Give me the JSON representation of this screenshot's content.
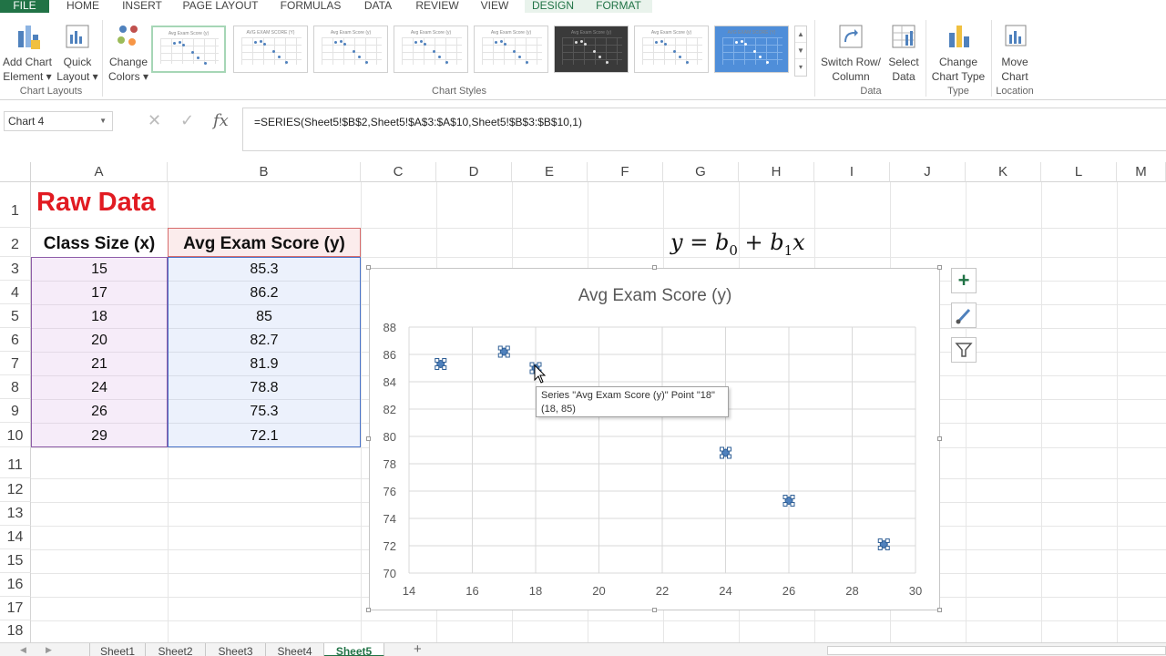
{
  "ribbon": {
    "tabs": [
      {
        "label": "FILE",
        "kind": "file"
      },
      {
        "label": "HOME"
      },
      {
        "label": "INSERT"
      },
      {
        "label": "PAGE LAYOUT"
      },
      {
        "label": "FORMULAS"
      },
      {
        "label": "DATA"
      },
      {
        "label": "REVIEW"
      },
      {
        "label": "VIEW"
      },
      {
        "label": "DESIGN",
        "kind": "ctx"
      },
      {
        "label": "FORMAT",
        "kind": "ctx"
      }
    ],
    "add_chart_element": {
      "line1": "Add Chart",
      "line2": "Element ▾"
    },
    "quick_layout": {
      "line1": "Quick",
      "line2": "Layout ▾"
    },
    "change_colors": {
      "line1": "Change",
      "line2": "Colors ▾"
    },
    "group_chart_layouts": "Chart Layouts",
    "group_chart_styles": "Chart Styles",
    "switch_row_column": {
      "line1": "Switch Row/",
      "line2": "Column"
    },
    "select_data": {
      "line1": "Select",
      "line2": "Data"
    },
    "group_data": "Data",
    "change_chart_type": {
      "line1": "Change",
      "line2": "Chart Type"
    },
    "group_type": "Type",
    "move_chart": {
      "line1": "Move",
      "line2": "Chart"
    },
    "group_location": "Location",
    "style_thumbnails": 8
  },
  "formula_bar": {
    "name_box": "Chart 4",
    "cancel_glyph": "✕",
    "enter_glyph": "✓",
    "fx_glyph": "fx",
    "formula": "=SERIES(Sheet5!$B$2,Sheet5!$A$3:$A$10,Sheet5!$B$3:$B$10,1)"
  },
  "grid": {
    "columns": [
      "A",
      "B",
      "C",
      "D",
      "E",
      "F",
      "G",
      "H",
      "I",
      "J",
      "K",
      "L",
      "M"
    ],
    "rows": [
      "1",
      "2",
      "3",
      "4",
      "5",
      "6",
      "7",
      "8",
      "9",
      "10",
      "11",
      "12",
      "13",
      "14",
      "15",
      "16",
      "17",
      "18"
    ],
    "title": "Raw Data",
    "header_x": "Class Size (x)",
    "header_y": "Avg Exam Score (y)",
    "data": [
      {
        "x": "15",
        "y": "85.3"
      },
      {
        "x": "17",
        "y": "86.2"
      },
      {
        "x": "18",
        "y": "85"
      },
      {
        "x": "20",
        "y": "82.7"
      },
      {
        "x": "21",
        "y": "81.9"
      },
      {
        "x": "24",
        "y": "78.8"
      },
      {
        "x": "26",
        "y": "75.3"
      },
      {
        "x": "29",
        "y": "72.1"
      }
    ]
  },
  "equation": {
    "y": "y",
    "eq": " = ",
    "b": "b",
    "s0": "0",
    "plus": " + ",
    "s1": "1",
    "x": "x"
  },
  "chart_data": {
    "type": "scatter",
    "title": "Avg Exam Score (y)",
    "xlim": [
      14,
      30
    ],
    "ylim": [
      70,
      88
    ],
    "x_ticks": [
      "14",
      "16",
      "18",
      "20",
      "22",
      "24",
      "26",
      "28",
      "30"
    ],
    "y_ticks": [
      "70",
      "72",
      "74",
      "76",
      "78",
      "80",
      "82",
      "84",
      "86",
      "88"
    ],
    "grid": true,
    "marker_color": "#4f81bd",
    "series": [
      {
        "name": "Avg Exam Score (y)",
        "points": [
          {
            "x": 15,
            "y": 85.3
          },
          {
            "x": 17,
            "y": 86.2
          },
          {
            "x": 18,
            "y": 85
          },
          {
            "x": 24,
            "y": 78.8
          },
          {
            "x": 26,
            "y": 75.3
          },
          {
            "x": 29,
            "y": 72.1
          }
        ]
      }
    ]
  },
  "tooltip": {
    "line1": "Series \"Avg Exam Score (y)\" Point \"18\"",
    "line2": "(18, 85)"
  },
  "chart_tools": {
    "add_element": "+",
    "styles": "brush",
    "filter": "filter"
  },
  "sheets": {
    "tabs": [
      "Sheet1",
      "Sheet2",
      "Sheet3",
      "Sheet4",
      "Sheet5"
    ],
    "active": "Sheet5",
    "add": "+"
  },
  "colors": {
    "excel_green": "#217346",
    "title_red": "#e11b22",
    "series_blue": "#4f81bd"
  }
}
